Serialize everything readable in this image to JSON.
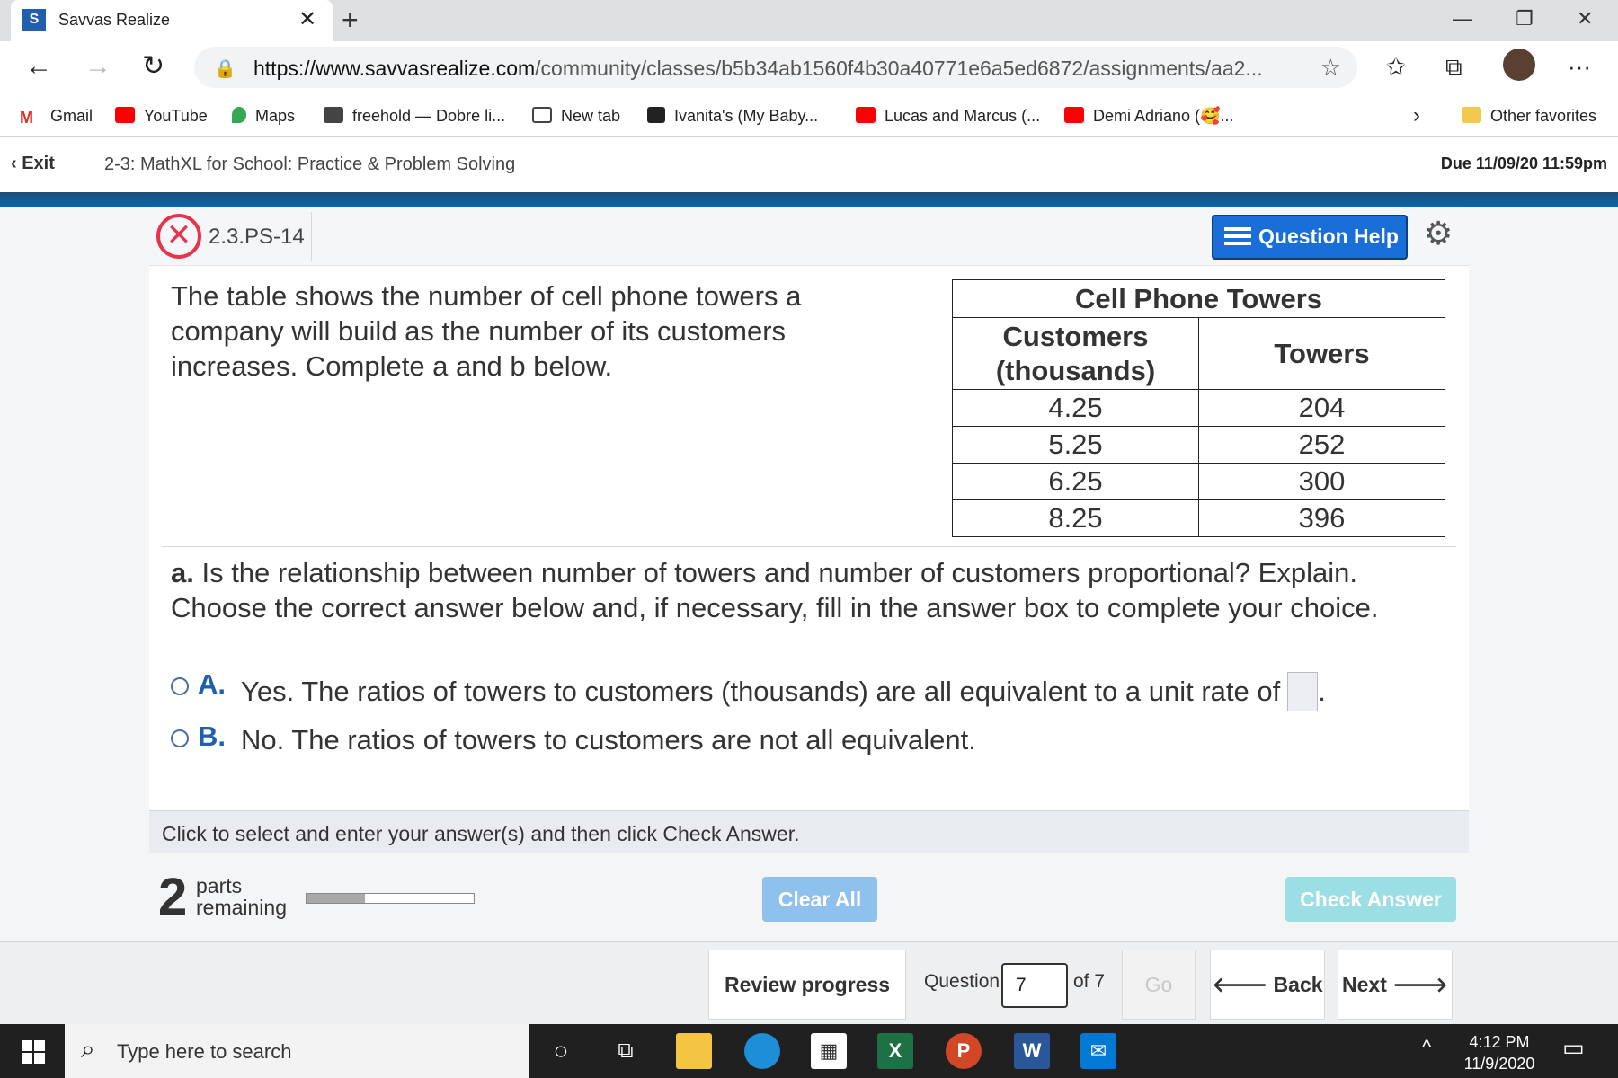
{
  "browser": {
    "tab_title": "Savvas Realize",
    "tab_favicon": "S",
    "url_domain": "https://www.savvasrealize.com",
    "url_path": "/community/classes/b5b34ab1560f4b30a40771e6a5ed6872/assignments/aa2...",
    "bookmarks": [
      {
        "label": "Gmail",
        "icon": "gmail-icon",
        "color": "#d93025"
      },
      {
        "label": "YouTube",
        "icon": "youtube-icon",
        "color": "#ff0000"
      },
      {
        "label": "Maps",
        "icon": "maps-icon",
        "color": "#34a853"
      },
      {
        "label": "freehold — Dobre li...",
        "icon": "cube-icon",
        "color": "#444444"
      },
      {
        "label": "New tab",
        "icon": "newtab-icon",
        "color": "#444444"
      },
      {
        "label": "Ivanita's (My Baby...",
        "icon": "facebook-icon",
        "color": "#222222"
      },
      {
        "label": "Lucas and Marcus (...",
        "icon": "youtube-icon",
        "color": "#ff0000"
      },
      {
        "label": "Demi Adriano (🥰...",
        "icon": "youtube-icon",
        "color": "#ff0000"
      }
    ],
    "other_favorites": "Other favorites"
  },
  "header": {
    "exit_label": "Exit",
    "assignment_title": "2-3: MathXL for School: Practice & Problem Solving",
    "due": "Due 11/09/20 11:59pm"
  },
  "question": {
    "id": "2.3.PS-14",
    "help_label": "Question Help",
    "prompt": "The table shows the number of cell phone towers a company will build as the number of its customers increases. Complete a and b below.",
    "table": {
      "caption": "Cell Phone Towers",
      "col1_line1": "Customers",
      "col1_line2": "(thousands)",
      "col2": "Towers",
      "rows": [
        {
          "customers": "4.25",
          "towers": "204"
        },
        {
          "customers": "5.25",
          "towers": "252"
        },
        {
          "customers": "6.25",
          "towers": "300"
        },
        {
          "customers": "8.25",
          "towers": "396"
        }
      ]
    },
    "part_a_label": "a.",
    "part_a_text": " Is the relationship between number of towers and number of customers proportional? Explain.",
    "part_a_instruction": "Choose the correct answer below and, if necessary, fill in the answer box to complete your choice.",
    "choices": [
      {
        "letter": "A.",
        "text": "Yes. The ratios of towers to customers (thousands) are all equivalent to a unit rate of",
        "suffix": "."
      },
      {
        "letter": "B.",
        "text": "No. The ratios of towers to customers are not all equivalent."
      }
    ],
    "hint": "Click to select and enter your answer(s) and then click Check Answer.",
    "parts_remaining": "2",
    "parts_label_1": "parts",
    "parts_label_2": "remaining",
    "progress": 0.35,
    "clear_all": "Clear All",
    "check_answer": "Check Answer"
  },
  "navigation": {
    "review_progress": "Review progress",
    "question_label": "Question",
    "question_value": "7",
    "of_label": "of 7",
    "go": "Go",
    "back": "Back",
    "next": "Next"
  },
  "taskbar": {
    "search_placeholder": "Type here to search",
    "time": "4:12 PM",
    "date": "11/9/2020"
  }
}
